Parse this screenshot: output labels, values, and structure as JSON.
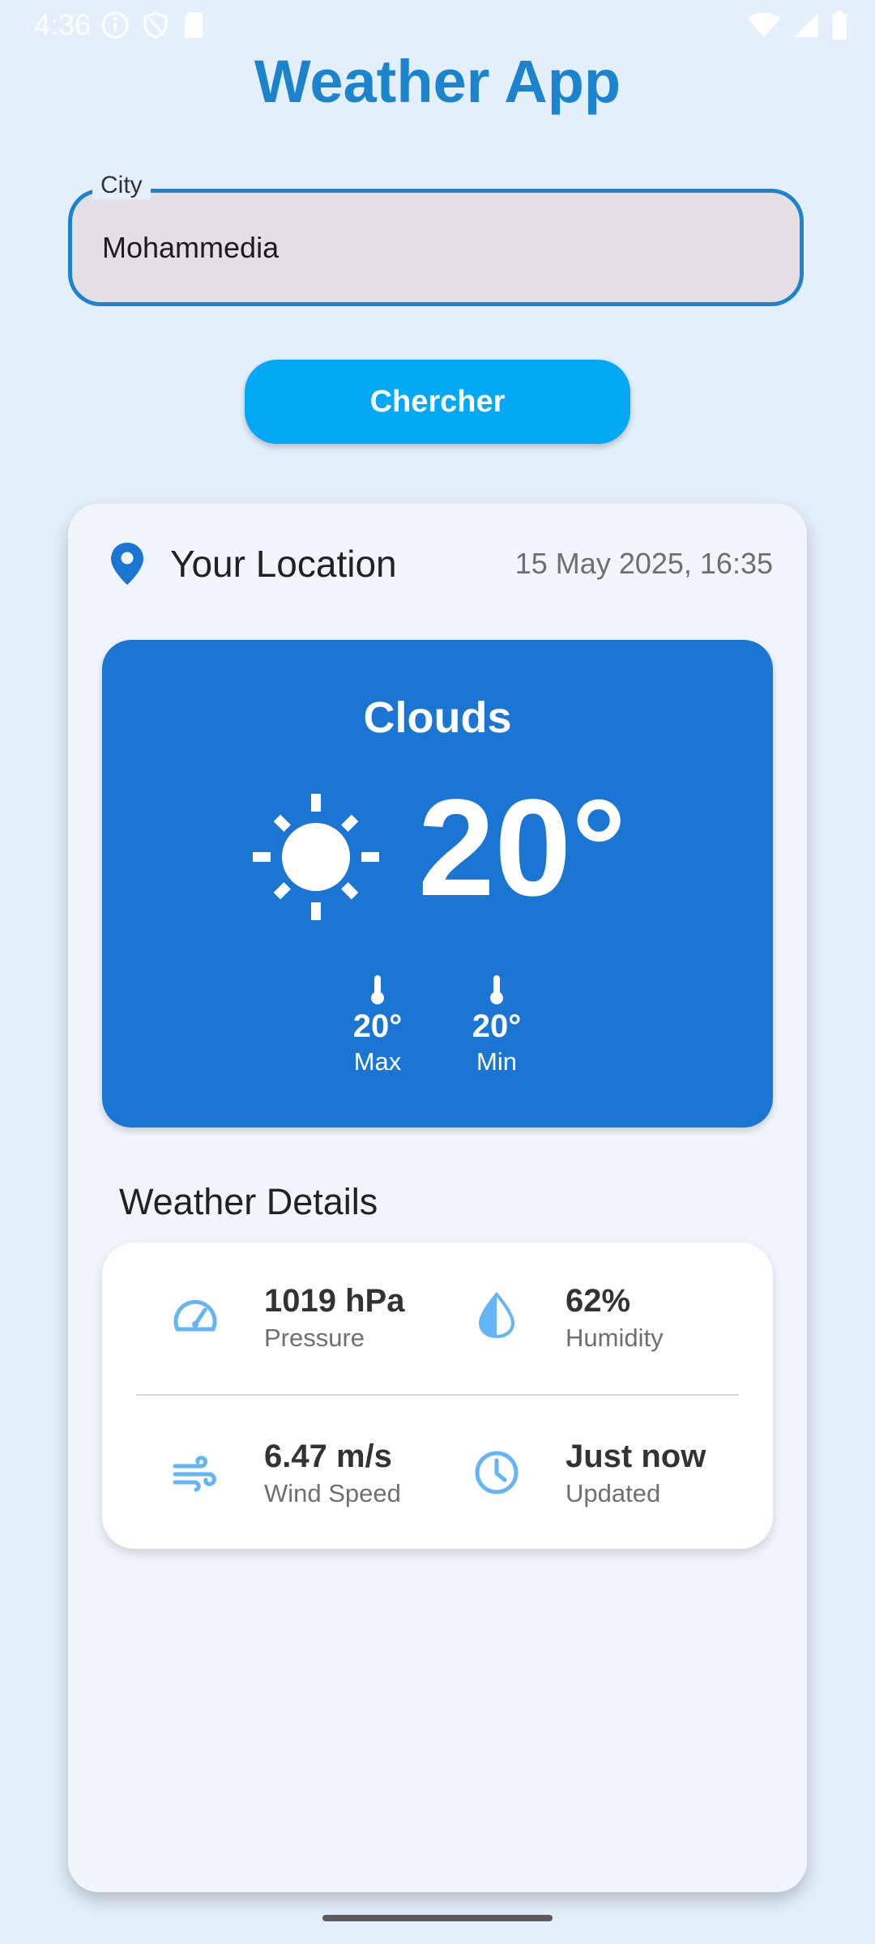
{
  "status_bar": {
    "time": "4:36",
    "left_icons": [
      "info-icon",
      "shield-icon",
      "sd-card-icon"
    ],
    "right_icons": [
      "wifi-icon",
      "signal-icon",
      "battery-icon"
    ]
  },
  "header": {
    "title": "Weather App"
  },
  "search": {
    "label": "City",
    "value": "Mohammedia",
    "button_label": "Chercher"
  },
  "location": {
    "icon": "location-pin-icon",
    "title": "Your Location",
    "timestamp": "15 May 2025, 16:35"
  },
  "current_weather": {
    "condition": "Clouds",
    "icon": "sun-icon",
    "temperature": "20°",
    "max_value": "20°",
    "max_label": "Max",
    "min_value": "20°",
    "min_label": "Min"
  },
  "details": {
    "heading": "Weather Details",
    "items": [
      {
        "icon": "speedometer-icon",
        "value": "1019 hPa",
        "label": "Pressure"
      },
      {
        "icon": "drop-icon",
        "value": "62%",
        "label": "Humidity"
      },
      {
        "icon": "wind-icon",
        "value": "6.47 m/s",
        "label": "Wind Speed"
      },
      {
        "icon": "clock-icon",
        "value": "Just now",
        "label": "Updated"
      }
    ]
  },
  "colors": {
    "background": "#e3f0fb",
    "title": "#1b84cd",
    "button": "#03a9f4",
    "weather_panel": "#1a76d2",
    "detail_icon": "#64b5f6"
  }
}
